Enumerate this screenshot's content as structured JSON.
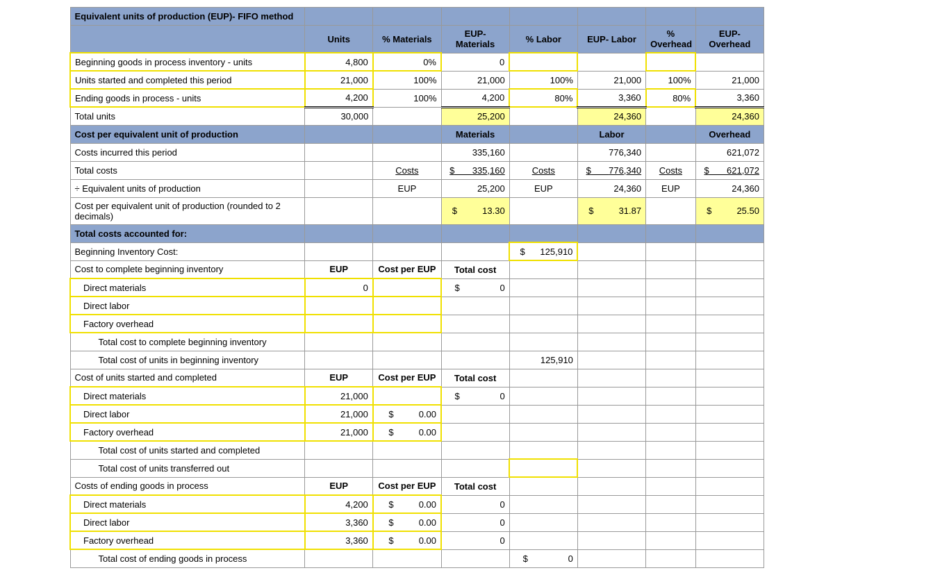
{
  "title": "Equivalent units of production (EUP)- FIFO method",
  "headers": {
    "units": "Units",
    "pctMat": "% Materials",
    "eupMat": "EUP- Materials",
    "pctLab": "% Labor",
    "eupLab": "EUP- Labor",
    "pctOH": "% Overhead",
    "eupOH": "EUP- Overhead"
  },
  "rows": {
    "begInv": {
      "label": "Beginning goods in process inventory - units",
      "units": "4,800",
      "pctMat": "0%",
      "eupMat": "0"
    },
    "started": {
      "label": "Units started and completed this period",
      "units": "21,000",
      "pctMat": "100%",
      "eupMat": "21,000",
      "pctLab": "100%",
      "eupLab": "21,000",
      "pctOH": "100%",
      "eupOH": "21,000"
    },
    "ending": {
      "label": "Ending goods in process - units",
      "units": "4,200",
      "pctMat": "100%",
      "eupMat": "4,200",
      "pctLab": "80%",
      "eupLab": "3,360",
      "pctOH": "80%",
      "eupOH": "3,360"
    },
    "totalUnits": {
      "label": "Total units",
      "units": "30,000",
      "eupMat": "25,200",
      "eupLab": "24,360",
      "eupOH": "24,360"
    }
  },
  "cpeu": {
    "title": "Cost per equivalent unit of production",
    "mat": "Materials",
    "lab": "Labor",
    "oh": "Overhead"
  },
  "costs": {
    "incurred": {
      "label": "Costs incurred this period",
      "mat": "335,160",
      "lab": "776,340",
      "oh": "621,072"
    },
    "total": {
      "label": "Total costs",
      "word": "Costs",
      "matD": "$",
      "mat": "335,160",
      "lab": "776,340",
      "oh": "621,072"
    },
    "eup": {
      "label": "÷ Equivalent units of production",
      "word": "EUP",
      "mat": "25,200",
      "lab": "24,360",
      "oh": "24,360"
    },
    "per": {
      "label": "Cost per equivalent unit of production (rounded to 2 decimals)",
      "matD": "$",
      "mat": "13.30",
      "labD": "$",
      "lab": "31.87",
      "ohD": "$",
      "oh": "25.50"
    }
  },
  "acct": {
    "title": "Total costs accounted for:",
    "begCost": {
      "label": "Beginning Inventory Cost:",
      "d": "$",
      "v": "125,910"
    },
    "complBeg": {
      "label": "Cost to complete beginning inventory",
      "eup": "EUP",
      "cpe": "Cost per EUP",
      "tot": "Total cost"
    },
    "dm": {
      "label": "Direct materials",
      "eup": "0",
      "d": "$",
      "tot": "0"
    },
    "dl": {
      "label": "Direct labor"
    },
    "foh": {
      "label": "Factory overhead"
    },
    "totComplBeg": "Total cost to complete beginning inventory",
    "totBegInv": {
      "label": "Total cost of units in beginning inventory",
      "v": "125,910"
    },
    "startedCompl": {
      "label": "Cost of units started and completed",
      "eup": "EUP",
      "cpe": "Cost per EUP",
      "tot": "Total cost"
    },
    "sdm": {
      "label": "Direct materials",
      "eup": "21,000",
      "d": "$",
      "tot": "0"
    },
    "sdl": {
      "label": "Direct labor",
      "eup": "21,000",
      "d": "$",
      "v": "0.00"
    },
    "sfoh": {
      "label": "Factory overhead",
      "eup": "21,000",
      "d": "$",
      "v": "0.00"
    },
    "totStarted": "Total cost of units started and completed",
    "totTransferred": "Total cost of units transferred out",
    "endGoods": {
      "label": "Costs of ending goods in process",
      "eup": "EUP",
      "cpe": "Cost per EUP",
      "tot": "Total cost"
    },
    "edm": {
      "label": "Direct materials",
      "eup": "4,200",
      "d": "$",
      "v": "0.00",
      "tot": "0"
    },
    "edl": {
      "label": "Direct labor",
      "eup": "3,360",
      "d": "$",
      "v": "0.00",
      "tot": "0"
    },
    "efoh": {
      "label": "Factory overhead",
      "eup": "3,360",
      "d": "$",
      "v": "0.00",
      "tot": "0"
    },
    "totEnd": {
      "label": "Total cost of ending goods in process",
      "d": "$",
      "v": "0"
    }
  }
}
